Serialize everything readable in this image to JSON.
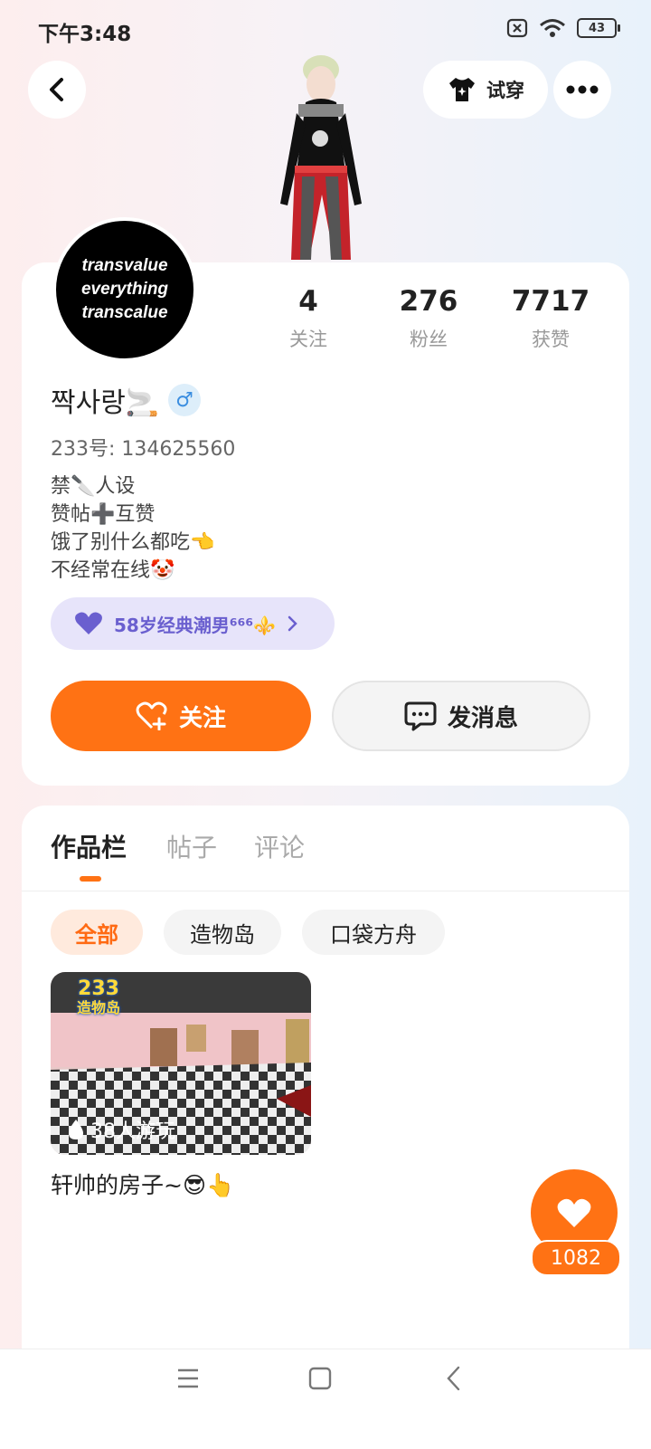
{
  "status_bar": {
    "time": "下午3:48",
    "battery": "43"
  },
  "header": {
    "tryon_label": "试穿"
  },
  "profile": {
    "avatar_lines": [
      "transvalue",
      "everything",
      "transcalue"
    ],
    "stats": [
      {
        "value": "4",
        "label": "关注"
      },
      {
        "value": "276",
        "label": "粉丝"
      },
      {
        "value": "7717",
        "label": "获赞"
      }
    ],
    "name": "짝사랑🚬",
    "gender_symbol": "♂",
    "uid": "233号: 134625560",
    "bio": [
      "禁🔪人设",
      "赞帖➕互赞",
      "饿了别什么都吃👈",
      "不经常在线🤡"
    ],
    "title_badge": "58岁经典潮男⁶⁶⁶⚜️",
    "follow_label": "关注",
    "message_label": "发消息"
  },
  "works": {
    "tabs": [
      "作品栏",
      "帖子",
      "评论"
    ],
    "filters": [
      "全部",
      "造物岛",
      "口袋方舟"
    ],
    "items": [
      {
        "title": "轩帅的房子~😎👆",
        "plays": "38人游玩",
        "badge_line1": "233",
        "badge_line2": "造物岛"
      }
    ]
  },
  "like_count": "1082",
  "colors": {
    "accent": "#ff7214",
    "badge": "#6a5fcf"
  }
}
